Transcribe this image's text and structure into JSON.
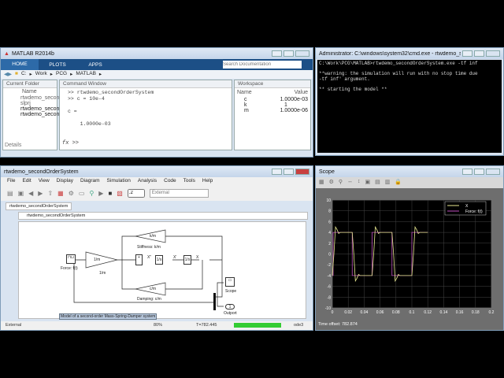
{
  "matlab": {
    "title": "MATLAB R2014b",
    "tabs": [
      "HOME",
      "PLOTS",
      "APPS"
    ],
    "search_placeholder": "Search Documentation",
    "path": [
      "C:",
      "Work",
      "PCG",
      "MATLAB"
    ],
    "current_folder": {
      "title": "Current Folder",
      "col": "Name",
      "items": [
        "rtwdemo_secon...",
        "slprj",
        "rtwdemo_secon...",
        "rtwdemo_secon..."
      ],
      "details": "Details"
    },
    "command_window": {
      "title": "Command Window",
      "lines": [
        ">> rtwdemo_secondOrderSystem",
        ">> c = 10e-4",
        "",
        "c =",
        "",
        "    1.0000e-03"
      ],
      "prompt": ">>",
      "fx": "fx"
    },
    "workspace": {
      "title": "Workspace",
      "cols": [
        "Name",
        "Value"
      ],
      "rows": [
        {
          "name": "c",
          "value": "1.0000e-03"
        },
        {
          "name": "k",
          "value": "1"
        },
        {
          "name": "m",
          "value": "1.0000e-06"
        }
      ]
    }
  },
  "cmd": {
    "title": "Administrator: C:\\windows\\system32\\cmd.exe - rtwdemo_seco...",
    "lines": [
      "C:\\Work\\PCG\\MATLAB>rtwdemo_secondOrderSystem.exe -tf inf",
      "",
      "**warning: the simulation will run with no stop time due",
      "-tf inf' argument.",
      "",
      "** starting the model **"
    ]
  },
  "simulink": {
    "title": "rtwdemo_secondOrderSystem",
    "menu": [
      "File",
      "Edit",
      "View",
      "Display",
      "Diagram",
      "Simulation",
      "Analysis",
      "Code",
      "Tools",
      "Help"
    ],
    "stop_time": ".2",
    "mode": "External",
    "tab": "rtwdemo_secondOrderSystem",
    "breadcrumb": "rtwdemo_secondOrderSystem",
    "blocks": {
      "force": "Force: f(t)",
      "gain_in": "1/m",
      "gain_in_label": "1/m",
      "stiff": "k/m",
      "stiff_label": "Stiffness: k/m",
      "damp": "c/m",
      "damp_label": "Damping: c/m",
      "int1": "1/s",
      "int2": "1/s",
      "sig_xdd": "X''",
      "sig_xd": "X'",
      "sig_x": "X",
      "scope": "Scope",
      "outport": "1",
      "outport_label": "Outport",
      "note": "Model of a second-order Mass-Spring-Damper system"
    },
    "status": {
      "mode": "External",
      "zoom": "80%",
      "time": "T=782.445",
      "solver": "ode3"
    }
  },
  "scope": {
    "title": "Scope",
    "time_offset_label": "Time offset:",
    "time_offset": "782.874",
    "chart_data": {
      "type": "line",
      "xlim": [
        0,
        0.2
      ],
      "ylim": [
        -10,
        10
      ],
      "xticks": [
        "0",
        "0.02",
        "0.04",
        "0.06",
        "0.08",
        "0.1",
        "0.12",
        "0.14",
        "0.16",
        "0.18",
        "0.2"
      ],
      "yticks": [
        "10",
        "8",
        "6",
        "4",
        "2",
        "0",
        "-2",
        "-4",
        "-6",
        "-8",
        "-10"
      ],
      "grid": true,
      "legend": "top-right",
      "series": [
        {
          "name": "X",
          "color": "#e8e890",
          "x": [
            0,
            0.002,
            0.004,
            0.006,
            0.008,
            0.01,
            0.025,
            0.027,
            0.029,
            0.031,
            0.033,
            0.035,
            0.05,
            0.052,
            0.054,
            0.056,
            0.058,
            0.06,
            0.075,
            0.077,
            0.079,
            0.081,
            0.083,
            0.085,
            0.1,
            0.102,
            0.104,
            0.106,
            0.108,
            0.11,
            0.12
          ],
          "y": [
            -4,
            0,
            5,
            4.5,
            3.8,
            4,
            4,
            0,
            -5,
            -4.5,
            -3.8,
            -4,
            -4,
            0,
            5,
            4.5,
            3.8,
            4,
            4,
            0,
            -5,
            -4.5,
            -3.8,
            -4,
            -4,
            0,
            5,
            4.5,
            3.8,
            4,
            4
          ]
        },
        {
          "name": "Force: f(t)",
          "color": "#c050c0",
          "x": [
            0,
            0.001,
            0.001,
            0.025,
            0.025,
            0.05,
            0.05,
            0.075,
            0.075,
            0.1,
            0.1,
            0.12
          ],
          "y": [
            -4,
            -4,
            4,
            4,
            -4,
            -4,
            4,
            4,
            -4,
            -4,
            4,
            4
          ]
        }
      ]
    }
  }
}
